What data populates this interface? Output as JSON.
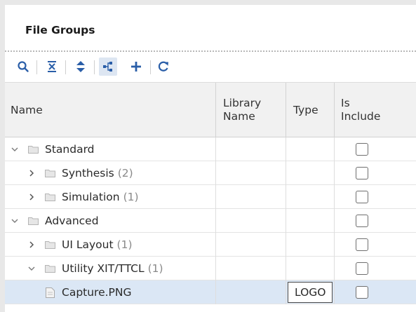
{
  "panel": {
    "title": "File Groups"
  },
  "toolbar": {
    "items": [
      {
        "name": "search-icon"
      },
      {
        "name": "collapse-all-icon"
      },
      {
        "name": "expand-all-icon"
      },
      {
        "name": "group-by-icon"
      },
      {
        "name": "add-icon"
      },
      {
        "name": "refresh-icon"
      }
    ]
  },
  "table": {
    "columns": {
      "name": "Name",
      "library_name": "Library Name",
      "type": "Type",
      "is_include": "Is Include"
    },
    "rows": [
      {
        "label": "Standard",
        "count": "",
        "expanded": true,
        "kind": "folder",
        "level": 0,
        "type": "",
        "checked": false
      },
      {
        "label": "Synthesis",
        "count": "(2)",
        "expanded": false,
        "kind": "folder",
        "level": 1,
        "type": "",
        "checked": false
      },
      {
        "label": "Simulation",
        "count": "(1)",
        "expanded": false,
        "kind": "folder",
        "level": 1,
        "type": "",
        "checked": false
      },
      {
        "label": "Advanced",
        "count": "",
        "expanded": true,
        "kind": "folder",
        "level": 0,
        "type": "",
        "checked": false
      },
      {
        "label": "UI Layout",
        "count": "(1)",
        "expanded": false,
        "kind": "folder",
        "level": 1,
        "type": "",
        "checked": false
      },
      {
        "label": "Utility XIT/TTCL",
        "count": "(1)",
        "expanded": true,
        "kind": "folder",
        "level": 1,
        "type": "",
        "checked": false
      },
      {
        "label": "Capture.PNG",
        "count": "",
        "expanded": false,
        "kind": "file",
        "level": 2,
        "type": "LOGO",
        "checked": false,
        "selected": true
      }
    ]
  },
  "colors": {
    "selection": "#dbe7f5",
    "header_bg": "#f1f1f1",
    "accent_blue": "#2a5ea8"
  }
}
